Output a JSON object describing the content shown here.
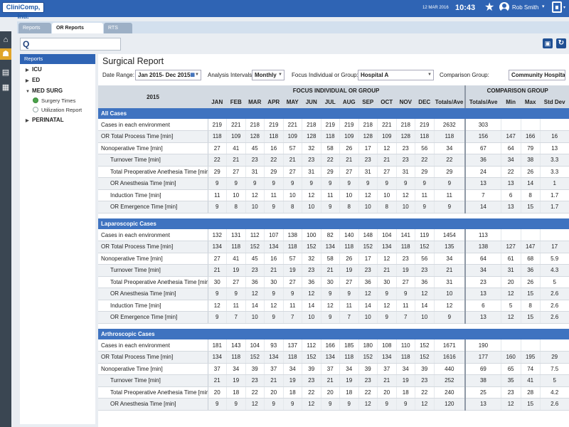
{
  "topbar": {
    "logo": "CliniComp, Intl.",
    "date": "12 MAR 2016",
    "time": "10:43",
    "user": "Rob Smith",
    "user_caret": "▾",
    "lock_caret": "▾",
    "star": "★"
  },
  "tabs": [
    "Reports",
    "OR Reports",
    "RTS"
  ],
  "search": {
    "value": "",
    "icon": "Q"
  },
  "rail_icons": [
    "home-icon",
    "person-icon",
    "monitor-icon",
    "grid-icon"
  ],
  "sidebar": {
    "title": "Reports",
    "items": [
      {
        "label": "ICU",
        "expanded": false
      },
      {
        "label": "ED",
        "expanded": false
      },
      {
        "label": "MED SURG",
        "expanded": true,
        "children": [
          {
            "label": "Surgery Times",
            "selected": true
          },
          {
            "label": "Utilization Report",
            "selected": false
          }
        ]
      },
      {
        "label": "PERINATAL",
        "expanded": false
      }
    ]
  },
  "report": {
    "title": "Surgical Report",
    "filters": {
      "date_range_label": "Date Range:",
      "date_range": "Jan 2015- Dec 2015",
      "interval_label": "Analysis Intervals:",
      "interval": "Monthly",
      "focus_label": "Focus Individual or Group:",
      "focus": "Hospital A",
      "comparison_label": "Comparison Group:",
      "comparison": "Community Hospitals"
    },
    "year": "2015",
    "focus_header": "FOCUS INDIVIDUAL OR GROUP",
    "comparison_header": "COMPARISON GROUP",
    "months": [
      "JAN",
      "FEB",
      "MAR",
      "APR",
      "MAY",
      "JUN",
      "JUL",
      "AUG",
      "SEP",
      "OCT",
      "NOV",
      "DEC"
    ],
    "focus_total_col": "Totals/Ave",
    "comparison_cols": [
      "Totals/Ave",
      "Min",
      "Max",
      "Std Dev"
    ],
    "sections": [
      {
        "title": "All Cases",
        "rows": [
          {
            "label": "Cases in each environment",
            "indent": false,
            "months": [
              "219",
              "221",
              "218",
              "219",
              "221",
              "218",
              "219",
              "219",
              "218",
              "221",
              "218",
              "219"
            ],
            "total": "2632",
            "comparison": [
              "303",
              "",
              "",
              ""
            ]
          },
          {
            "label": "OR Total Process Time [min]",
            "indent": false,
            "months": [
              "118",
              "109",
              "128",
              "118",
              "109",
              "128",
              "118",
              "109",
              "128",
              "109",
              "128",
              "118"
            ],
            "total": "118",
            "comparison": [
              "156",
              "147",
              "166",
              "16"
            ]
          },
          {
            "label": "Nonoperative Time [min]",
            "indent": false,
            "months": [
              "27",
              "41",
              "45",
              "16",
              "57",
              "32",
              "58",
              "26",
              "17",
              "12",
              "23",
              "56"
            ],
            "total": "34",
            "comparison": [
              "67",
              "64",
              "79",
              "13"
            ]
          },
          {
            "label": "Turnover Time [min]",
            "indent": true,
            "months": [
              "22",
              "21",
              "23",
              "22",
              "21",
              "23",
              "22",
              "21",
              "23",
              "21",
              "23",
              "22"
            ],
            "total": "22",
            "comparison": [
              "36",
              "34",
              "38",
              "3.3"
            ]
          },
          {
            "label": "Total Preoperative Anethesia Time [min]",
            "indent": true,
            "months": [
              "29",
              "27",
              "31",
              "29",
              "27",
              "31",
              "29",
              "27",
              "31",
              "27",
              "31",
              "29"
            ],
            "total": "29",
            "comparison": [
              "24",
              "22",
              "26",
              "3.3"
            ]
          },
          {
            "label": "OR Anesthesia Time [min]",
            "indent": true,
            "months": [
              "9",
              "9",
              "9",
              "9",
              "9",
              "9",
              "9",
              "9",
              "9",
              "9",
              "9",
              "9"
            ],
            "total": "9",
            "comparison": [
              "13",
              "13",
              "14",
              "1"
            ]
          },
          {
            "label": "Induction Time [min]",
            "indent": true,
            "months": [
              "11",
              "10",
              "12",
              "11",
              "10",
              "12",
              "11",
              "10",
              "12",
              "10",
              "12",
              "11"
            ],
            "total": "11",
            "comparison": [
              "7",
              "6",
              "8",
              "1.7"
            ]
          },
          {
            "label": "OR Emergence Time [min]",
            "indent": true,
            "months": [
              "9",
              "8",
              "10",
              "9",
              "8",
              "10",
              "9",
              "8",
              "10",
              "8",
              "10",
              "9"
            ],
            "total": "9",
            "comparison": [
              "14",
              "13",
              "15",
              "1.7"
            ]
          }
        ]
      },
      {
        "title": "Laparoscopic Cases",
        "rows": [
          {
            "label": "Cases in each environment",
            "indent": false,
            "months": [
              "132",
              "131",
              "112",
              "107",
              "138",
              "100",
              "82",
              "140",
              "148",
              "104",
              "141",
              "119"
            ],
            "total": "1454",
            "comparison": [
              "113",
              "",
              "",
              ""
            ]
          },
          {
            "label": "OR Total Process Time [min]",
            "indent": false,
            "months": [
              "134",
              "118",
              "152",
              "134",
              "118",
              "152",
              "134",
              "118",
              "152",
              "134",
              "118",
              "152"
            ],
            "total": "135",
            "comparison": [
              "138",
              "127",
              "147",
              "17"
            ]
          },
          {
            "label": "Nonoperative Time [min]",
            "indent": false,
            "months": [
              "27",
              "41",
              "45",
              "16",
              "57",
              "32",
              "58",
              "26",
              "17",
              "12",
              "23",
              "56"
            ],
            "total": "34",
            "comparison": [
              "64",
              "61",
              "68",
              "5.9"
            ]
          },
          {
            "label": "Turnover Time [min]",
            "indent": true,
            "months": [
              "21",
              "19",
              "23",
              "21",
              "19",
              "23",
              "21",
              "19",
              "23",
              "21",
              "19",
              "23"
            ],
            "total": "21",
            "comparison": [
              "34",
              "31",
              "36",
              "4.3"
            ]
          },
          {
            "label": "Total Preoperative Anethesia Time [min]",
            "indent": true,
            "months": [
              "30",
              "27",
              "36",
              "30",
              "27",
              "36",
              "30",
              "27",
              "36",
              "30",
              "27",
              "36"
            ],
            "total": "31",
            "comparison": [
              "23",
              "20",
              "26",
              "5"
            ]
          },
          {
            "label": "OR Anesthesia Time [min]",
            "indent": true,
            "months": [
              "9",
              "9",
              "12",
              "9",
              "9",
              "12",
              "9",
              "9",
              "12",
              "9",
              "9",
              "12"
            ],
            "total": "10",
            "comparison": [
              "13",
              "12",
              "15",
              "2.6"
            ]
          },
          {
            "label": "Induction Time [min]",
            "indent": true,
            "months": [
              "12",
              "11",
              "14",
              "12",
              "11",
              "14",
              "12",
              "11",
              "14",
              "12",
              "11",
              "14"
            ],
            "total": "12",
            "comparison": [
              "6",
              "5",
              "8",
              "2.6"
            ]
          },
          {
            "label": "OR Emergence Time [min]",
            "indent": true,
            "months": [
              "9",
              "7",
              "10",
              "9",
              "7",
              "10",
              "9",
              "7",
              "10",
              "9",
              "7",
              "10"
            ],
            "total": "9",
            "comparison": [
              "13",
              "12",
              "15",
              "2.6"
            ]
          }
        ]
      },
      {
        "title": "Arthroscopic Cases",
        "rows": [
          {
            "label": "Cases in each environment",
            "indent": false,
            "months": [
              "181",
              "143",
              "104",
              "93",
              "137",
              "112",
              "166",
              "185",
              "180",
              "108",
              "110",
              "152"
            ],
            "total": "1671",
            "comparison": [
              "190",
              "",
              "",
              ""
            ]
          },
          {
            "label": "OR Total Process Time [min]",
            "indent": false,
            "months": [
              "134",
              "118",
              "152",
              "134",
              "118",
              "152",
              "134",
              "118",
              "152",
              "134",
              "118",
              "152"
            ],
            "total": "1616",
            "comparison": [
              "177",
              "160",
              "195",
              "29"
            ]
          },
          {
            "label": "Nonoperative Time [min]",
            "indent": false,
            "months": [
              "37",
              "34",
              "39",
              "37",
              "34",
              "39",
              "37",
              "34",
              "39",
              "37",
              "34",
              "39"
            ],
            "total": "440",
            "comparison": [
              "69",
              "65",
              "74",
              "7.5"
            ]
          },
          {
            "label": "Turnover Time [min]",
            "indent": true,
            "months": [
              "21",
              "19",
              "23",
              "21",
              "19",
              "23",
              "21",
              "19",
              "23",
              "21",
              "19",
              "23"
            ],
            "total": "252",
            "comparison": [
              "38",
              "35",
              "41",
              "5"
            ]
          },
          {
            "label": "Total Preoperative Anethesia Time [min]",
            "indent": true,
            "months": [
              "20",
              "18",
              "22",
              "20",
              "18",
              "22",
              "20",
              "18",
              "22",
              "20",
              "18",
              "22"
            ],
            "total": "240",
            "comparison": [
              "25",
              "23",
              "28",
              "4.2"
            ]
          },
          {
            "label": "OR Anesthesia Time [min]",
            "indent": true,
            "months": [
              "9",
              "9",
              "12",
              "9",
              "9",
              "12",
              "9",
              "9",
              "12",
              "9",
              "9",
              "12"
            ],
            "total": "120",
            "comparison": [
              "13",
              "12",
              "15",
              "2.6"
            ]
          }
        ]
      }
    ]
  }
}
